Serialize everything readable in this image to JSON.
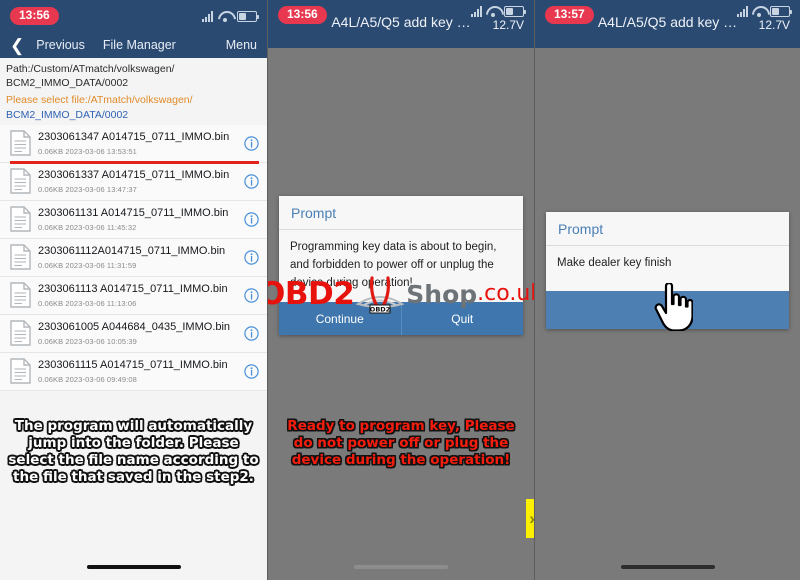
{
  "panels": {
    "left": {
      "status": {
        "time": "13:56"
      },
      "nav": {
        "back_icon": "chevron-left-icon",
        "previous": "Previous",
        "title": "File Manager",
        "menu": "Menu"
      },
      "path": {
        "path_label": "Path:/Custom/ATmatch/volkswagen/",
        "path_label2": "BCM2_IMMO_DATA/0002",
        "select_label": "Please select file:/ATmatch/volkswagen/",
        "select_label2": "BCM2_IMMO_DATA/0002"
      },
      "files": [
        {
          "name": "2303061347 A014715_0711_IMMO.bin",
          "meta": "0.06KB 2023-03-06 13:53:51",
          "highlighted": true
        },
        {
          "name": "2303061337 A014715_0711_IMMO.bin",
          "meta": "0.06KB 2023-03-06 13:47:37",
          "highlighted": false
        },
        {
          "name": "2303061131 A014715_0711_IMMO.bin",
          "meta": "0.06KB 2023-03-06 11:45:32",
          "highlighted": false
        },
        {
          "name": "2303061112A014715_0711_IMMO.bin",
          "meta": "0.06KB 2023-03-06 11:31:59",
          "highlighted": false
        },
        {
          "name": "2303061113 A014715_0711_IMMO.bin",
          "meta": "0.06KB 2023-03-06 11:13:06",
          "highlighted": false
        },
        {
          "name": "2303061005 A044684_0435_IMMO.bin",
          "meta": "0.06KB 2023-03-06 10:05:39",
          "highlighted": false
        },
        {
          "name": "2303061115 A014715_0711_IMMO.bin",
          "meta": "0.06KB 2023-03-06 09:49:08",
          "highlighted": false
        }
      ],
      "caption": "The program will automatically jump into the folder. Please select the file name according to the file that saved in the step2."
    },
    "middle": {
      "status": {
        "time": "13:56",
        "title": "A4L/A5/Q5 add key …",
        "voltage": "12.7V"
      },
      "dialog": {
        "header": "Prompt",
        "body": "Programming key data is about to begin, and forbidden to power off or unplug the device during operation!",
        "buttons": [
          "Continue",
          "Quit"
        ]
      },
      "caption": "Ready to program key, Please do not power off or plug the device during the operation!",
      "side_tab_icon": "double-chevron-right-icon"
    },
    "right": {
      "status": {
        "time": "13:57",
        "title": "A4L/A5/Q5 add key …",
        "voltage": "12.7V"
      },
      "dialog": {
        "header": "Prompt",
        "body": "Make dealer key finish",
        "buttons": []
      }
    }
  },
  "watermark": {
    "brand": "OBD2",
    "logo_text": "OBD2",
    "shop": "Shop",
    "domain": ".co.uk"
  },
  "colors": {
    "statusbar": "#2b4a72",
    "accent_blue": "#3f76ad",
    "time_pill": "#e8384f",
    "red_underline": "#e2231a",
    "orange_text": "#e08b2a",
    "link_blue": "#2f63b5",
    "caption_red": "#f51d0e",
    "yellow_tab": "#fcf000",
    "panel_gray": "#7a7a7a"
  }
}
